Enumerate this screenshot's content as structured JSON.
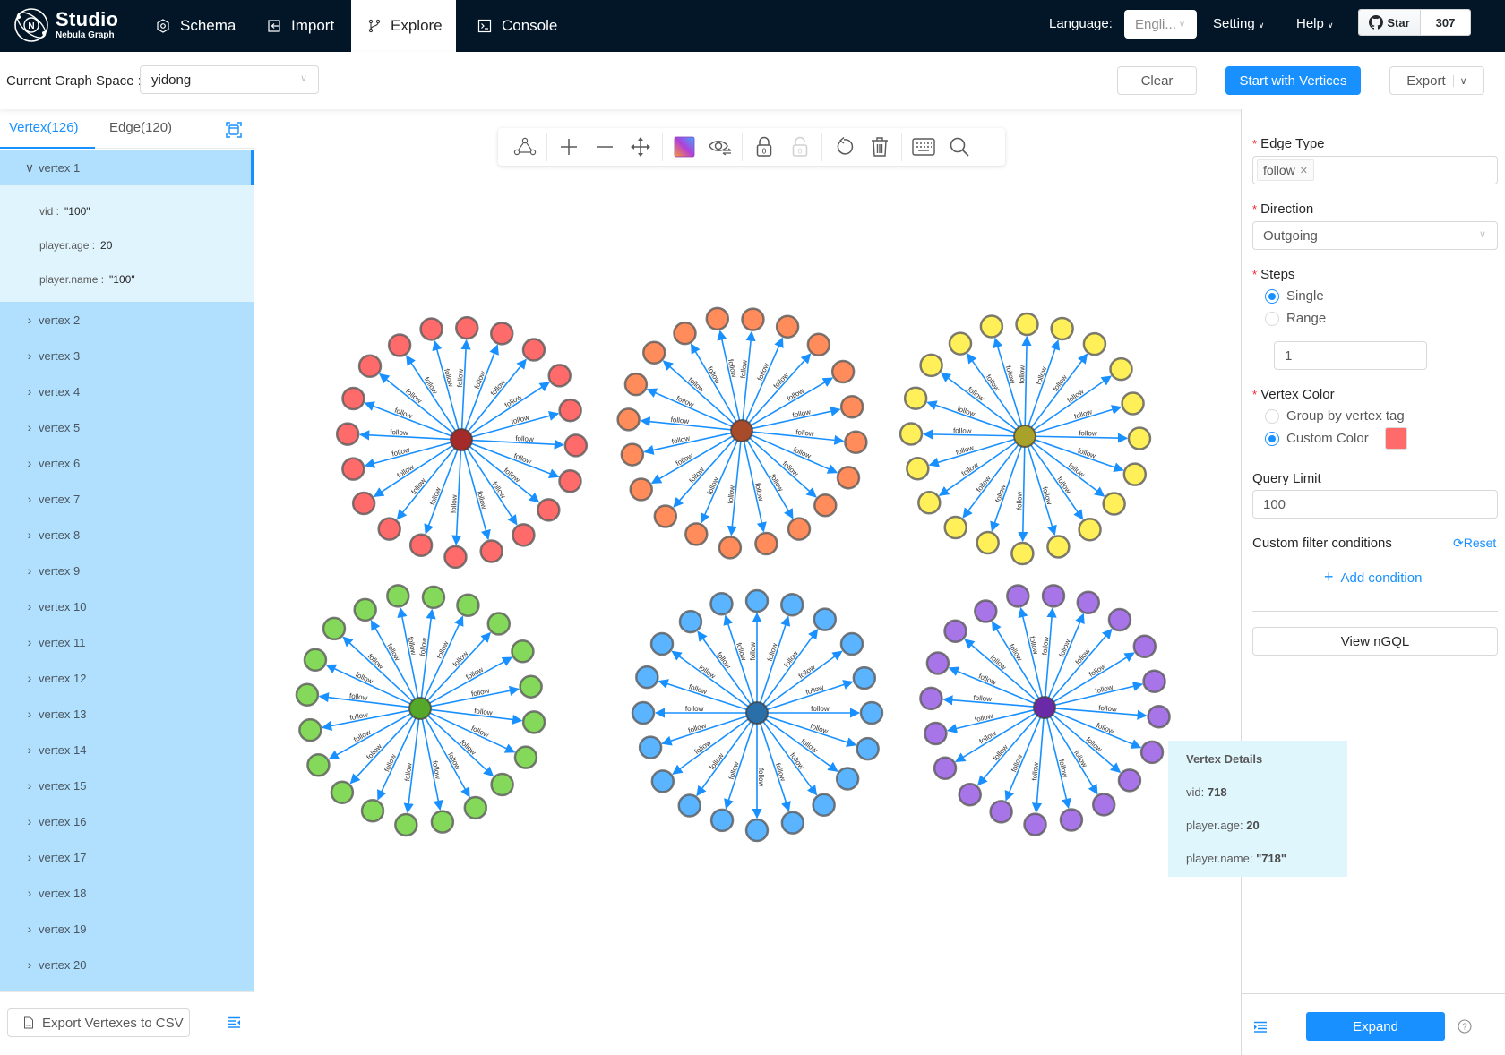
{
  "app": {
    "logo_title": "Studio",
    "logo_subtitle": "Nebula Graph"
  },
  "nav": {
    "items": [
      {
        "label": "Schema",
        "icon": "schema-icon",
        "active": false
      },
      {
        "label": "Import",
        "icon": "import-icon",
        "active": false
      },
      {
        "label": "Explore",
        "icon": "explore-icon",
        "active": true
      },
      {
        "label": "Console",
        "icon": "console-icon",
        "active": false
      }
    ],
    "language_label": "Language:",
    "language_value": "Engli...",
    "setting_label": "Setting",
    "help_label": "Help",
    "github_star_label": "Star",
    "github_star_count": "307"
  },
  "toolbar_top": {
    "graph_space_label": "Current Graph Space :",
    "graph_space_value": "yidong",
    "clear_label": "Clear",
    "start_label": "Start with Vertices",
    "export_label": "Export"
  },
  "left_panel": {
    "tabs": [
      {
        "label": "Vertex(126)",
        "active": true
      },
      {
        "label": "Edge(120)",
        "active": false
      }
    ],
    "expanded_vertex": {
      "label": "vertex 1",
      "properties": [
        {
          "key": "vid :",
          "value": "\"100\""
        },
        {
          "key": "player.age :",
          "value": "20"
        },
        {
          "key": "player.name :",
          "value": "\"100\""
        }
      ]
    },
    "vertices": [
      "vertex 2",
      "vertex 3",
      "vertex 4",
      "vertex 5",
      "vertex 6",
      "vertex 7",
      "vertex 8",
      "vertex 9",
      "vertex 10",
      "vertex 11",
      "vertex 12",
      "vertex 13",
      "vertex 14",
      "vertex 15",
      "vertex 16",
      "vertex 17",
      "vertex 18",
      "vertex 19",
      "vertex 20"
    ],
    "export_csv_label": "Export Vertexes to CSV"
  },
  "canvas_toolbar": {
    "tools": [
      "create-edge",
      "zoom-in",
      "zoom-out",
      "move",
      "color-picker",
      "show-hide",
      "lock",
      "unlock",
      "undo",
      "delete",
      "shortcuts",
      "search"
    ],
    "lock_count": "0",
    "unlock_count": "0"
  },
  "graph": {
    "edge_label": "follow",
    "edge_color": "#1890ff",
    "leaves_per_cluster": 20,
    "clusters": [
      {
        "name": "red",
        "center_fill": "#a52a2a",
        "leaf_fill": "#ff6b6b"
      },
      {
        "name": "orange",
        "center_fill": "#a84b2a",
        "leaf_fill": "#ff8c5a"
      },
      {
        "name": "yellow",
        "center_fill": "#a8a22a",
        "leaf_fill": "#fff05a"
      },
      {
        "name": "green",
        "center_fill": "#55a82a",
        "leaf_fill": "#85d95a"
      },
      {
        "name": "blue",
        "center_fill": "#2a6fa8",
        "leaf_fill": "#5ab4ff"
      },
      {
        "name": "purple",
        "center_fill": "#6a2aa8",
        "leaf_fill": "#a875e8"
      }
    ]
  },
  "tooltip": {
    "title": "Vertex Details",
    "rows": [
      {
        "key": "vid:",
        "value": "718"
      },
      {
        "key": "player.age:",
        "value": "20"
      },
      {
        "key": "player.name:",
        "value": "\"718\""
      }
    ]
  },
  "right_panel": {
    "edge_type_label": "Edge Type",
    "edge_type_tag": "follow",
    "direction_label": "Direction",
    "direction_value": "Outgoing",
    "steps_label": "Steps",
    "steps_options": [
      {
        "label": "Single",
        "checked": true
      },
      {
        "label": "Range",
        "checked": false
      }
    ],
    "steps_value": "1",
    "vertex_color_label": "Vertex Color",
    "vertex_color_options": [
      {
        "label": "Group by vertex tag",
        "checked": false
      },
      {
        "label": "Custom Color",
        "checked": true
      }
    ],
    "custom_color": "#ff6b6b",
    "query_limit_label": "Query Limit",
    "query_limit_value": "100",
    "filter_label": "Custom filter conditions",
    "reset_label": "Reset",
    "add_condition_label": "Add condition",
    "view_ngql_label": "View nGQL",
    "expand_label": "Expand"
  }
}
